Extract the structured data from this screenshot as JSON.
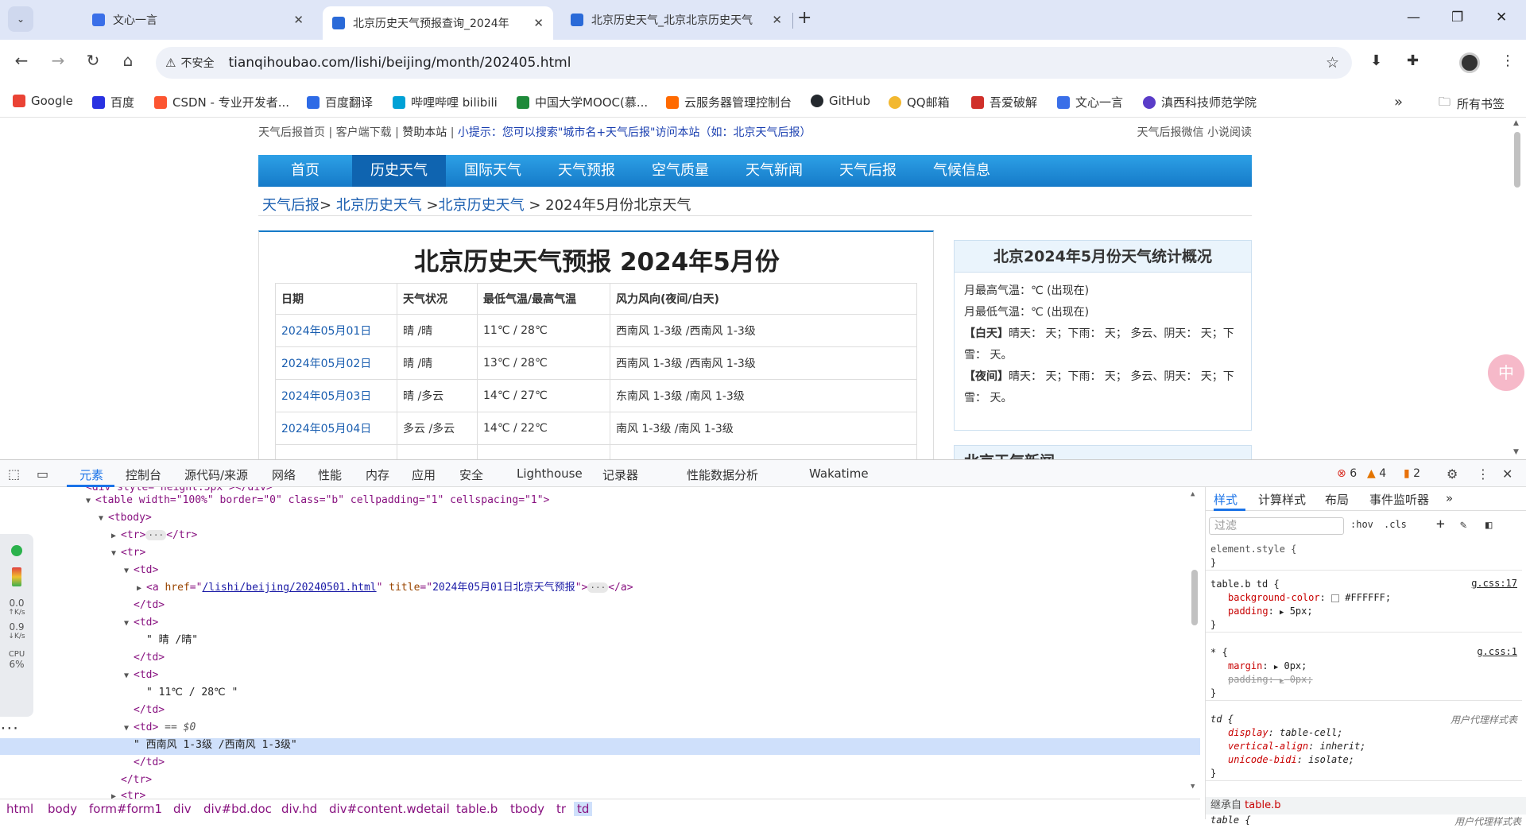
{
  "browser": {
    "tabs": [
      {
        "title": "文心一言",
        "active": false
      },
      {
        "title": "北京历史天气预报查询_2024年",
        "active": true
      },
      {
        "title": "北京历史天气_北京北京历史天气",
        "active": false
      }
    ],
    "security_label": "不安全",
    "url": "tianqihoubao.com/lishi/beijing/month/202405.html",
    "bookmarks": [
      "Google",
      "百度",
      "CSDN - 专业开发者...",
      "百度翻译",
      "哔哩哔哩 bilibili",
      "中国大学MOOC(慕...",
      "云服务器管理控制台",
      "GitHub",
      "QQ邮箱",
      "吾爱破解",
      "文心一言",
      "滇西科技师范学院"
    ],
    "all_bookmarks": "所有书签"
  },
  "page": {
    "topbar": {
      "home": "天气后报首页",
      "client": "客户端下载",
      "sponsor": "赞助本站",
      "tip": "小提示：您可以搜索\"城市名+天气后报\"访问本站（如：北京天气后报）",
      "right": "天气后报微信 小说阅读"
    },
    "nav": [
      "首页",
      "历史天气",
      "国际天气",
      "天气预报",
      "空气质量",
      "天气新闻",
      "天气后报",
      "气候信息"
    ],
    "breadcrumb": {
      "a": "天气后报",
      "b": "北京历史天气",
      "c": "北京历史天气",
      "current": "2024年5月份北京天气"
    },
    "title": "北京历史天气预报 2024年5月份",
    "table": {
      "headers": [
        "日期",
        "天气状况",
        "最低气温/最高气温",
        "风力风向(夜间/白天)"
      ],
      "rows": [
        [
          "2024年05月01日",
          "晴 /晴",
          "11℃ / 28℃",
          "西南风 1-3级 /西南风 1-3级"
        ],
        [
          "2024年05月02日",
          "晴 /晴",
          "13℃ / 28℃",
          "西南风 1-3级 /西南风 1-3级"
        ],
        [
          "2024年05月03日",
          "晴 /多云",
          "14℃ / 27℃",
          "东南风 1-3级 /南风 1-3级"
        ],
        [
          "2024年05月04日",
          "多云 /多云",
          "14℃ / 22℃",
          "南风 1-3级 /南风 1-3级"
        ]
      ]
    },
    "stats": {
      "title": "北京2024年5月份天气统计概况",
      "max_temp": "月最高气温：℃ (出现在)",
      "min_temp": "月最低气温：℃ (出现在)",
      "day_label": "【白天】",
      "day_text": "晴天： 天；下雨： 天； 多云、阴天： 天；下雪： 天。",
      "night_label": "【夜间】",
      "night_text": "晴天： 天；下雨： 天； 多云、阴天： 天；下雪： 天。"
    },
    "news_title": "北京天气新闻"
  },
  "devtools": {
    "tabs": [
      "元素",
      "控制台",
      "源代码/来源",
      "网络",
      "性能",
      "内存",
      "应用",
      "安全",
      "Lighthouse",
      "记录器",
      "性能数据分析",
      "Wakatime"
    ],
    "errors": "6",
    "warnings": "4",
    "issues": "2",
    "dom": {
      "table_open": "<table width=\"100%\" border=\"0\" class=\"b\" cellpadding=\"1\" cellspacing=\"1\">",
      "tbody": "<tbody>",
      "tr_collapsed": "<tr>",
      "tr_close": "</tr>",
      "tr": "<tr>",
      "td": "<td>",
      "td_close": "</td>",
      "a_href": "/lishi/beijing/20240501.html",
      "a_title": "2024年05月01日北京天气预报",
      "text1": "\" 晴 /晴\"",
      "text2": "\" 11℃ / 28℃ \"",
      "text3": "\" 西南风 1-3级 /西南风 1-3级\"",
      "selected_marker": "== $0"
    },
    "crumbs": [
      "html",
      "body",
      "form#form1",
      "div",
      "div#bd.doc",
      "div.hd",
      "div#content.wdetail",
      "table.b",
      "tbody",
      "tr",
      "td"
    ],
    "perf": {
      "up": "0.0",
      "down": "0.9",
      "unit": "K/s",
      "cpu_label": "CPU",
      "cpu": "6%"
    },
    "styles": {
      "tabs": [
        "样式",
        "计算样式",
        "布局",
        "事件监听器"
      ],
      "filter_placeholder": "过滤",
      "hov": ":hov",
      "cls": ".cls",
      "element_style": "element.style {",
      "rule1_selector": "table.b td {",
      "rule1_src": "g.css:17",
      "rule1_p1": "background-color",
      "rule1_v1": "#FFFFFF;",
      "rule1_p2": "padding",
      "rule1_v2": "5px;",
      "rule2_selector": "* {",
      "rule2_src": "g.css:1",
      "rule2_p1": "margin",
      "rule2_v1": "0px;",
      "rule2_p2": "padding",
      "rule2_v2": "0px;",
      "ua_selector": "td {",
      "ua_label": "用户代理样式表",
      "ua_p1": "display",
      "ua_v1": "table-cell;",
      "ua_p2": "vertical-align",
      "ua_v2": "inherit;",
      "ua_p3": "unicode-bidi",
      "ua_v3": "isolate;",
      "close": "}",
      "inherited_label": "继承自",
      "inherited_from": "table.b",
      "next_selector": "table {"
    }
  }
}
